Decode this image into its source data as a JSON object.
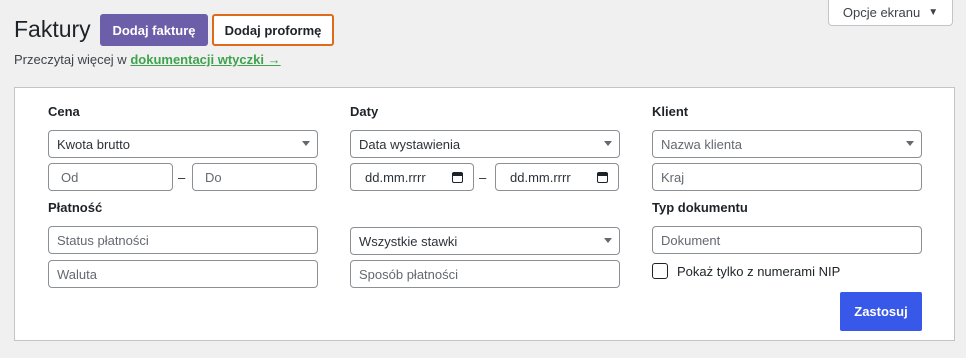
{
  "header": {
    "title": "Faktury",
    "add_invoice": "Dodaj fakturę",
    "add_proforma": "Dodaj proformę",
    "screen_options": "Opcje ekranu",
    "read_more_prefix": "Przeczytaj więcej w",
    "read_more_link": "dokumentacji wtyczki →"
  },
  "filters": {
    "price": {
      "label": "Cena",
      "select_value": "Kwota brutto",
      "from_placeholder": "Od",
      "to_placeholder": "Do",
      "dash": "–"
    },
    "dates": {
      "label": "Daty",
      "select_value": "Data wystawienia",
      "date_from": "dd.mm.rrrr",
      "date_to": "dd.mm.rrrr",
      "dash": "–"
    },
    "client": {
      "label": "Klient",
      "name_placeholder": "Nazwa klienta",
      "country_placeholder": "Kraj"
    },
    "payment": {
      "label": "Płatność",
      "status_placeholder": "Status płatności",
      "currency_placeholder": "Waluta"
    },
    "tax": {
      "rates_value": "Wszystkie stawki",
      "method_placeholder": "Sposób płatności"
    },
    "doc_type": {
      "label": "Typ dokumentu",
      "document_placeholder": "Dokument",
      "nip_only_label": "Pokaż tylko z numerami NIP",
      "nip_only_checked": false
    },
    "apply_button": "Zastosuj"
  },
  "colors": {
    "primary_purple": "#6c5ea8",
    "outline_orange": "#e06a1b",
    "link_green": "#3fa34d",
    "apply_blue": "#3858e9"
  }
}
